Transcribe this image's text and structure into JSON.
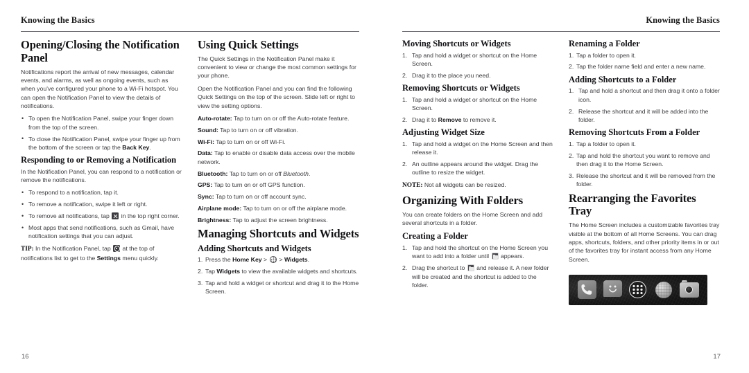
{
  "document": {
    "running_head": "Knowing the Basics"
  },
  "left_page": {
    "folio": "16",
    "col1": {
      "h_notification_panel": "Opening/Closing the Notification Panel",
      "p_notifications_intro": "Notifications report the arrival of new messages, calendar events, and alarms, as well as ongoing events, such as when you've configured your phone to a Wi-Fi hotspot. You can open the Notification Panel to view the details of notifications.",
      "bullets_panel": [
        "To open the Notification Panel, swipe your finger down from the top of the screen.",
        "To close the Notification Panel, swipe your finger up from the bottom of the screen or tap the Back Key."
      ],
      "bullet_close_pre": "To close the Notification Panel, swipe your finger up from the bottom of the screen or tap the ",
      "bullet_close_bold": "Back Key",
      "bullet_close_post": ".",
      "h_responding": "Responding to or Removing a Notification",
      "p_responding_intro": "In the Notification Panel, you can respond to a notification or remove the notifications.",
      "bullet_respond": "To respond to a notification, tap it.",
      "bullet_remove_one": "To remove a notification, swipe it left or right.",
      "bullet_remove_all_pre": "To remove all notifications, tap",
      "bullet_remove_all_post": "in the top right corner.",
      "bullet_most_apps": "Most apps that send notifications, such as Gmail, have notification settings that you can adjust.",
      "tip_label": "TIP:",
      "tip_pre": "In the Notification Panel, tap",
      "tip_mid": "at the top of notifications list to get to the",
      "tip_bold": "Settings",
      "tip_post": "menu quickly."
    },
    "col2": {
      "h_quick_settings": "Using Quick Settings",
      "p_quick_intro": "The Quick Settings in the Notification Panel make it convenient to view or change the most common settings for your phone.",
      "p_quick_open": "Open the Notification Panel and you can find the following Quick Settings on the top of the screen. Slide left or right to view the setting options.",
      "settings": [
        {
          "term": "Auto-rotate:",
          "desc": " Tap to turn on or off the Auto-rotate feature."
        },
        {
          "term": "Sound:",
          "desc": " Tap to turn on or off vibration."
        },
        {
          "term": "Wi-Fi:",
          "desc": " Tap to turn on or off Wi-Fi."
        },
        {
          "term": "Data:",
          "desc": " Tap to enable or disable data access over the mobile network."
        },
        {
          "term": "Bluetooth:",
          "desc_pre": " Tap to turn on or off ",
          "desc_italic": "Bluetooth",
          "desc_post": "."
        },
        {
          "term": "GPS:",
          "desc": " Tap to turn on or off GPS function."
        },
        {
          "term": "Sync:",
          "desc": " Tap to turn on or off account sync."
        },
        {
          "term": "Airplane mode:",
          "desc": " Tap to turn on or off the airplane mode."
        },
        {
          "term": "Brightness:",
          "desc": " Tap to adjust the screen brightness."
        }
      ],
      "h_managing": "Managing Shortcuts and Widgets",
      "h_adding": "Adding Shortcuts and Widgets",
      "step1_pre": "Press the ",
      "step1_home_key": "Home Key",
      "step1_gt1": " > ",
      "step1_gt2": " > ",
      "step1_widgets": "Widgets",
      "step1_post": ".",
      "step2_pre": "Tap ",
      "step2_bold": "Widgets",
      "step2_post": " to view the available widgets and shortcuts.",
      "step3": "Tap and hold a widget or shortcut and drag it to the Home Screen."
    }
  },
  "right_page": {
    "folio": "17",
    "col3": {
      "h_moving": "Moving Shortcuts or Widgets",
      "moving_steps": [
        "Tap and hold a widget or shortcut on the Home Screen.",
        "Drag it to the place you need."
      ],
      "h_removing": "Removing Shortcuts or Widgets",
      "removing_step1": "Tap and hold a widget or shortcut on the Home Screen.",
      "removing_step2_pre": "Drag it to ",
      "removing_step2_bold": "Remove",
      "removing_step2_post": " to remove it.",
      "h_adjusting": "Adjusting Widget Size",
      "adjusting_steps": [
        "Tap and hold a widget on the Home Screen and then release it.",
        "An outline appears around the widget. Drag the outline to resize the widget."
      ],
      "note_label": "NOTE:",
      "note_text": "Not all widgets can be resized.",
      "h_organizing": "Organizing With Folders",
      "p_organizing": "You can create folders on the Home Screen and add several shortcuts in a folder.",
      "h_creating": "Creating a Folder",
      "creating_step1_pre": "Tap and hold the shortcut on the Home Screen you want to add into a folder until",
      "creating_step1_post": "appears.",
      "creating_step2_pre": "Drag the shortcut to",
      "creating_step2_post": "and release it. A new folder will be created and the shortcut is added to the folder."
    },
    "col4": {
      "h_renaming": "Renaming a Folder",
      "renaming_steps": [
        "Tap a folder to open it.",
        "Tap the folder name field and enter a new name."
      ],
      "h_adding_to_folder": "Adding Shortcuts to a Folder",
      "adding_steps": [
        "Tap and hold a shortcut and then drag it onto a folder icon.",
        "Release the shortcut and it will be added into the folder."
      ],
      "h_removing_from_folder": "Removing Shortcuts From a Folder",
      "removing_from_steps": [
        "Tap a folder to open it.",
        "Tap and hold the shortcut you want to remove and then drag it to the Home Screen.",
        "Release the shortcut and it will be removed from the folder."
      ],
      "h_rearranging": "Rearranging the Favorites Tray",
      "p_rearranging": "The Home Screen includes a customizable favorites tray visible at the bottom of all Home Screens. You can drag apps, shortcuts, folders, and other priority items in or out of the favorites tray for instant access from any Home Screen.",
      "tray_icons": [
        "phone-icon",
        "messaging-icon",
        "app-drawer-icon",
        "browser-globe-icon",
        "camera-icon"
      ]
    }
  }
}
